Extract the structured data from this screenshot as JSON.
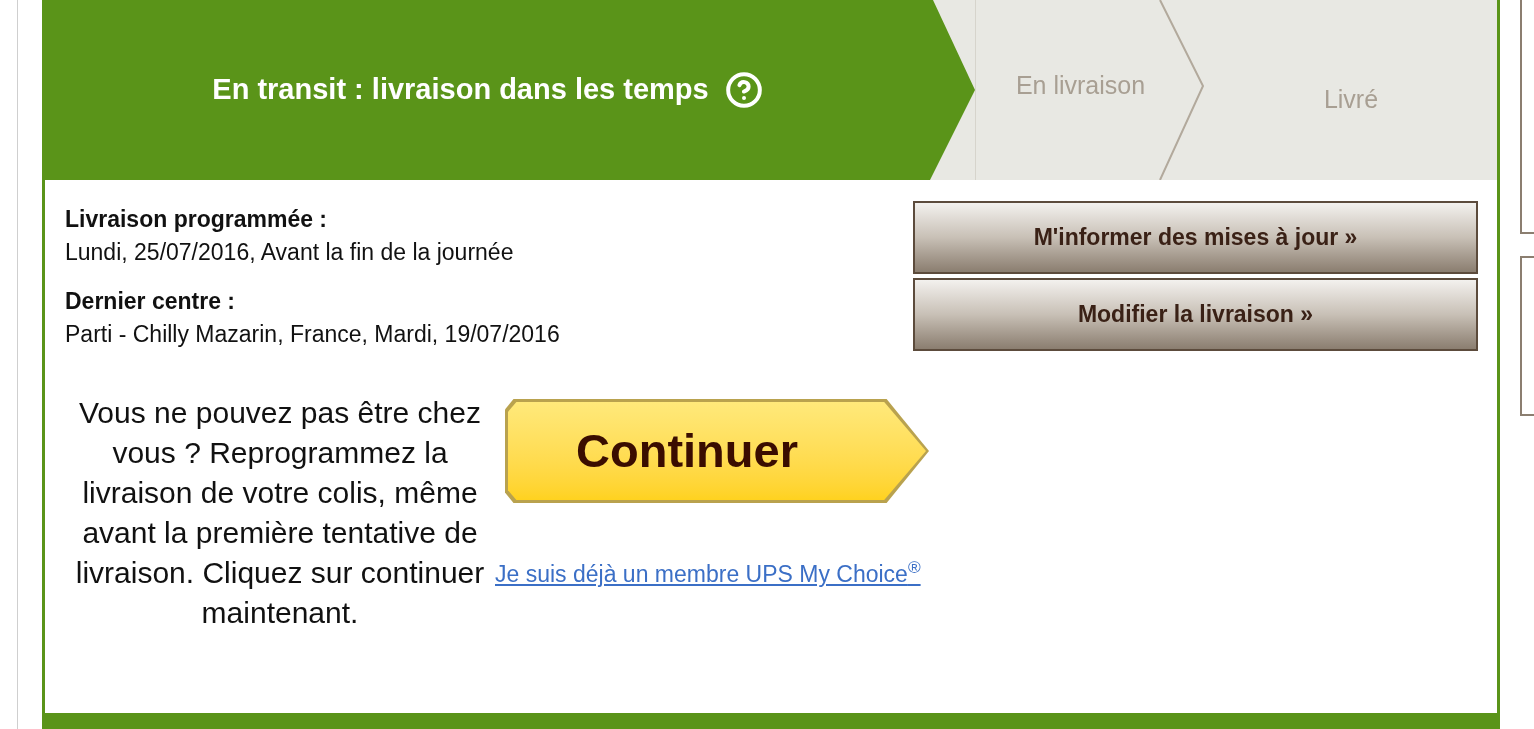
{
  "steps": [
    {
      "label": "En transit : livraison dans les temps",
      "active": true,
      "help": true
    },
    {
      "label": "En livraison",
      "active": false
    },
    {
      "label": "Livré",
      "active": false
    }
  ],
  "details": [
    {
      "heading": "Livraison programmée :",
      "value": "Lundi, 25/07/2016, Avant la fin de la journée"
    },
    {
      "heading": "Dernier centre :",
      "value": "Parti - Chilly Mazarin, France, Mardi, 19/07/2016"
    }
  ],
  "actions": [
    "M'informer des mises à jour »",
    "Modifier la livraison »"
  ],
  "reschedule": {
    "message": "Vous ne pouvez pas être chez vous ? Reprogrammez la livraison de votre colis, même avant la première tentative de livraison. Cliquez sur continuer maintenant.",
    "button": "Continuer",
    "link": "Je suis déjà un membre UPS My Choice$^{®}$"
  }
}
